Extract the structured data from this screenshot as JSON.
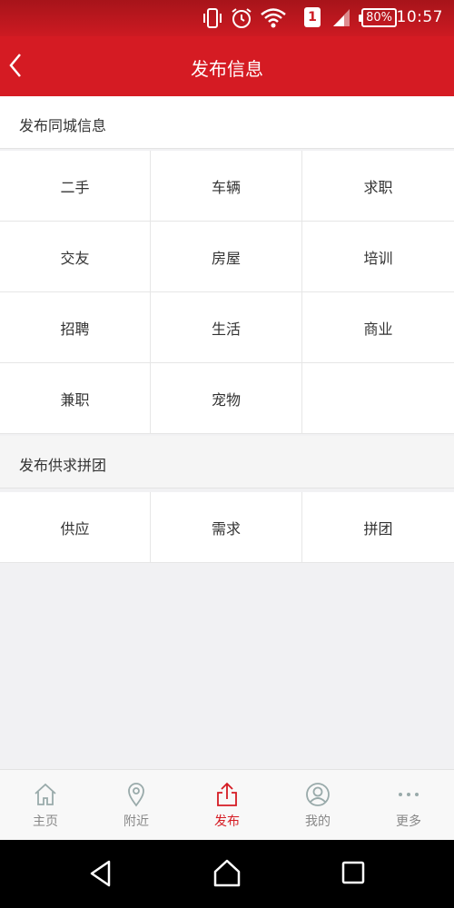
{
  "status_bar": {
    "time": "10:57",
    "battery": "80%",
    "sim": "1"
  },
  "header": {
    "title": "发布信息"
  },
  "section_local": {
    "title": "发布同城信息",
    "items": [
      "二手",
      "车辆",
      "求职",
      "交友",
      "房屋",
      "培训",
      "招聘",
      "生活",
      "商业",
      "兼职",
      "宠物"
    ]
  },
  "section_supply": {
    "title": "发布供求拼团",
    "items": [
      "供应",
      "需求",
      "拼团"
    ]
  },
  "tabs": [
    {
      "label": "主页",
      "icon": "home-icon"
    },
    {
      "label": "附近",
      "icon": "location-pin-icon"
    },
    {
      "label": "发布",
      "icon": "share-upload-icon",
      "active": true
    },
    {
      "label": "我的",
      "icon": "user-icon"
    },
    {
      "label": "更多",
      "icon": "more-dots-icon"
    }
  ],
  "colors": {
    "primary": "#d51b23",
    "statusbar": "#b8161d",
    "background": "#f1f1f3"
  }
}
